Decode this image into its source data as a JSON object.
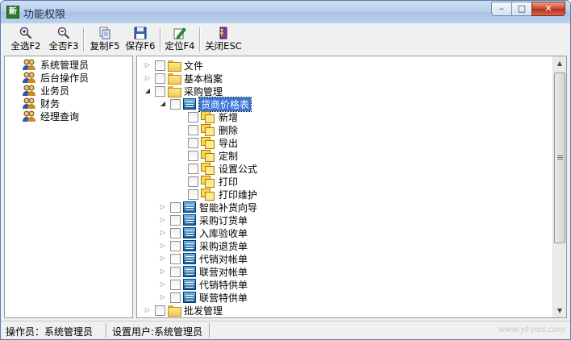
{
  "window": {
    "title": "功能权限",
    "app_icon_text": "新",
    "minimize_glyph": "–",
    "maximize_glyph": "□",
    "close_glyph": "✕"
  },
  "toolbar": {
    "select_all_label": "全选F2",
    "select_none_label": "全否F3",
    "copy_label": "复制F5",
    "save_label": "保存F6",
    "locate_label": "定位F4",
    "close_label": "关闭ESC",
    "icons": [
      "plus-magnifier-icon",
      "minus-magnifier-icon",
      "copy-page-icon",
      "floppy-disk-icon",
      "pencil-locate-icon",
      "exit-door-icon"
    ]
  },
  "roles": [
    {
      "label": "系统管理员"
    },
    {
      "label": "后台操作员"
    },
    {
      "label": "业务员"
    },
    {
      "label": "财务"
    },
    {
      "label": "经理查询"
    }
  ],
  "tree": {
    "top_folders": [
      {
        "label": "文件",
        "expanded": false
      },
      {
        "label": "基本档案",
        "expanded": false
      },
      {
        "label": "采购管理",
        "expanded": true
      }
    ],
    "selected_form": {
      "label": "货商价格表",
      "expanded": true
    },
    "operations": [
      {
        "label": "新增"
      },
      {
        "label": "删除"
      },
      {
        "label": "导出"
      },
      {
        "label": "定制"
      },
      {
        "label": "设置公式"
      },
      {
        "label": "打印"
      },
      {
        "label": "打印维护"
      }
    ],
    "forms": [
      {
        "label": "智能补货向导"
      },
      {
        "label": "采购订货单"
      },
      {
        "label": "入库验收单"
      },
      {
        "label": "采购退货单"
      },
      {
        "label": "代销对帐单"
      },
      {
        "label": "联营对帐单"
      },
      {
        "label": "代销特供单"
      },
      {
        "label": "联营特供单"
      }
    ],
    "bottom_folder": {
      "label": "批发管理",
      "expanded": false
    },
    "expand_collapsed_glyph": "▷",
    "expand_open_glyph": "◢"
  },
  "status": {
    "operator": "操作员：系统管理员",
    "setting_user": "设置用户:系统管理员",
    "watermark": "www.yt-pos.com"
  }
}
